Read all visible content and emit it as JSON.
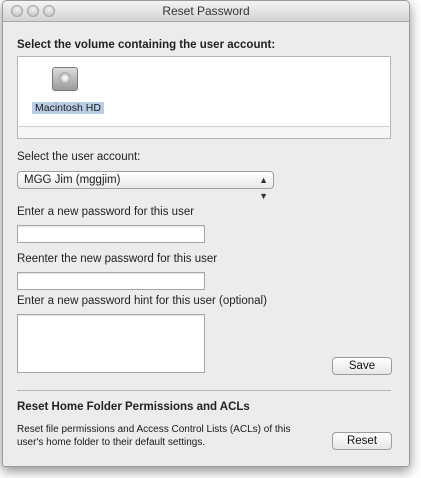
{
  "window": {
    "title": "Reset Password"
  },
  "volume": {
    "heading": "Select the volume containing the user account:",
    "items": [
      {
        "label": "Macintosh HD",
        "icon": "hard-drive-icon",
        "selected": true
      }
    ]
  },
  "user": {
    "label": "Select the user account:",
    "selected": "MGG Jim (mggjim)"
  },
  "password": {
    "new_label": "Enter a new password for this user",
    "reenter_label": "Reenter the new password for this user",
    "hint_label": "Enter a new password hint for this user (optional)",
    "new_value": "",
    "reenter_value": "",
    "hint_value": ""
  },
  "actions": {
    "save_label": "Save"
  },
  "acl": {
    "heading": "Reset Home Folder Permissions and ACLs",
    "description_line1": "Reset file permissions and Access Control Lists (ACLs) of this",
    "description_line2": "user's home folder to their default settings.",
    "reset_label": "Reset"
  }
}
